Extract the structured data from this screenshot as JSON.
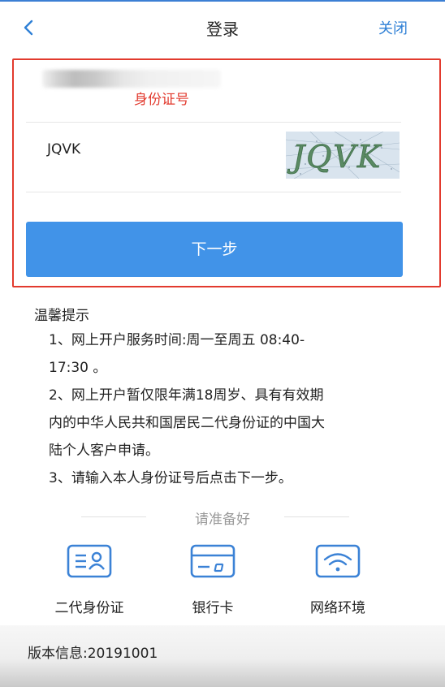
{
  "nav": {
    "back_glyph": "<",
    "title": "登录",
    "close_label": "关闭"
  },
  "form": {
    "id_annotation": "身份证号",
    "captcha_value": "JQVK",
    "captcha_image_text": "JQVK",
    "next_label": "下一步"
  },
  "tips": {
    "title": "温馨提示",
    "lines": [
      "1、网上开户服务时间:周一至周五 08:40-",
      "17:30 。",
      "2、网上开户暂仅限年满18周岁、具有有效期",
      "内的中华人民共和国居民二代身份证的中国大",
      "陆个人客户申请。",
      "3、请输入本人身份证号后点击下一步。"
    ]
  },
  "prepare": {
    "label": "请准备好",
    "items": [
      {
        "icon": "id-card-icon",
        "label": "二代身份证"
      },
      {
        "icon": "bank-card-icon",
        "label": "银行卡"
      },
      {
        "icon": "wifi-icon",
        "label": "网络环境"
      }
    ]
  },
  "footer": {
    "version": "版本信息:20191001"
  },
  "colors": {
    "accent": "#2f80d6",
    "button": "#4193e8",
    "highlight": "#e23a2e",
    "icon": "#3b82d6"
  }
}
